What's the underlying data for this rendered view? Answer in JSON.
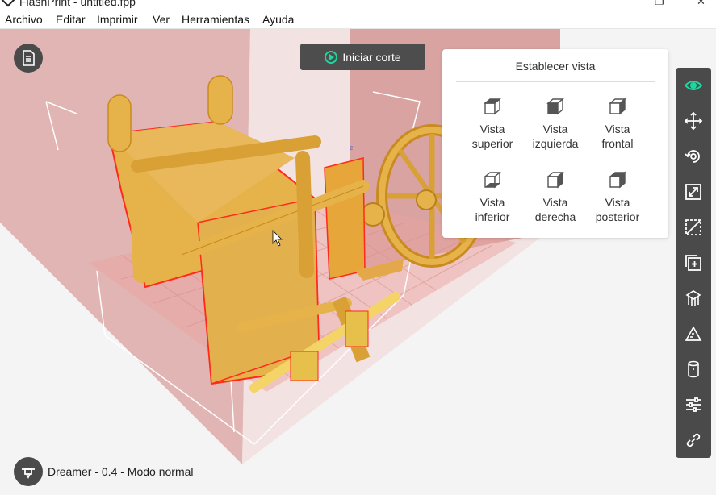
{
  "window": {
    "title": "FlashPrint - untitled.fpp"
  },
  "menu": [
    "Archivo",
    "Editar",
    "Imprimir",
    "Ver",
    "Herramientas",
    "Ayuda"
  ],
  "toolbar_top": {
    "slice_button": "Iniciar corte"
  },
  "view_panel": {
    "title": "Establecer vista",
    "options": [
      {
        "line1": "Vista",
        "line2": "superior",
        "icon": "cube-top-view-icon"
      },
      {
        "line1": "Vista",
        "line2": "izquierda",
        "icon": "cube-left-view-icon"
      },
      {
        "line1": "Vista",
        "line2": "frontal",
        "icon": "cube-front-view-icon"
      },
      {
        "line1": "Vista",
        "line2": "inferior",
        "icon": "cube-bottom-view-icon"
      },
      {
        "line1": "Vista",
        "line2": "derecha",
        "icon": "cube-right-view-icon"
      },
      {
        "line1": "Vista",
        "line2": "posterior",
        "icon": "cube-back-view-icon"
      }
    ]
  },
  "right_tools": [
    {
      "name": "view-tool",
      "icon": "eye-icon",
      "active": true
    },
    {
      "name": "move-tool",
      "icon": "move-arrows-icon"
    },
    {
      "name": "rotate-tool",
      "icon": "rotate-icon"
    },
    {
      "name": "scale-tool",
      "icon": "scale-icon"
    },
    {
      "name": "cut-tool",
      "icon": "cut-icon"
    },
    {
      "name": "add-tool",
      "icon": "add-icon"
    },
    {
      "name": "supports-tool",
      "icon": "supports-icon"
    },
    {
      "name": "ruler-tool",
      "icon": "ruler-icon"
    },
    {
      "name": "cylinder-tool",
      "icon": "cylinder-icon"
    },
    {
      "name": "settings-tool",
      "icon": "sliders-icon"
    },
    {
      "name": "link-tool",
      "icon": "link-icon"
    }
  ],
  "status": {
    "printer_text": "Dreamer - 0.4 - Modo normal"
  },
  "colors": {
    "accent": "#1fd6a0",
    "model": "#e6b34a",
    "model_selected_outline": "#ff2a1a",
    "toolbar_bg": "#4a4a4a",
    "build_volume": "#d9a6a4"
  }
}
